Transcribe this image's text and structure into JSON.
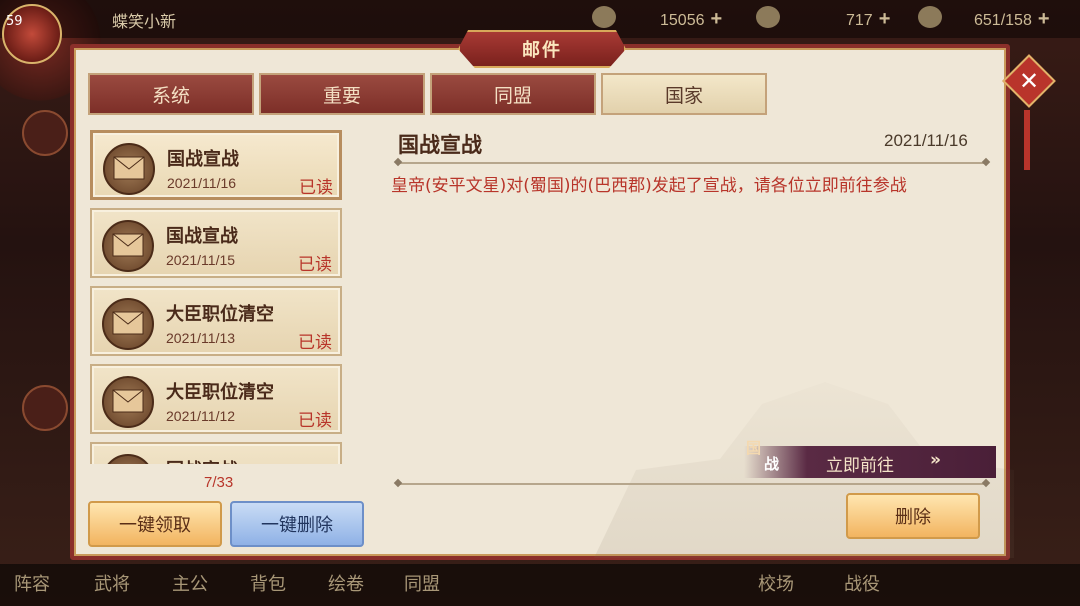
{
  "hud": {
    "level": "59",
    "player_name": "蝶笑小新",
    "resources": [
      {
        "icon": "silver-coin-icon",
        "value": "15056"
      },
      {
        "icon": "gold-ingot-icon",
        "value": "717"
      },
      {
        "icon": "grain-icon",
        "value": "651/158"
      }
    ],
    "bottom_nav": [
      "阵容",
      "武将",
      "主公",
      "背包",
      "绘卷",
      "同盟",
      "校场",
      "战役"
    ]
  },
  "dialog": {
    "title": "邮件",
    "close_icon": "close-icon",
    "tabs": [
      {
        "label": "系统",
        "active": false
      },
      {
        "label": "重要",
        "active": false
      },
      {
        "label": "同盟",
        "active": false
      },
      {
        "label": "国家",
        "active": true
      }
    ],
    "mails": [
      {
        "title": "国战宣战",
        "date": "2021/11/16",
        "status": "已读",
        "selected": true
      },
      {
        "title": "国战宣战",
        "date": "2021/11/15",
        "status": "已读",
        "selected": false
      },
      {
        "title": "大臣职位清空",
        "date": "2021/11/13",
        "status": "已读",
        "selected": false
      },
      {
        "title": "大臣职位清空",
        "date": "2021/11/12",
        "status": "已读",
        "selected": false
      },
      {
        "title": "国战宣战",
        "date": "",
        "status": "",
        "selected": false
      }
    ],
    "count": "7/33",
    "buttons": {
      "claim_all": "一键领取",
      "delete_all": "一键删除",
      "delete": "删除"
    },
    "detail": {
      "title": "国战宣战",
      "date": "2021/11/16",
      "body": "皇帝(安平文星)对(蜀国)的(巴西郡)发起了宣战，请各位立即前往参战"
    },
    "goto": {
      "badge_top": "国",
      "badge_bottom": "战",
      "label": "立即前往",
      "arrow": "»"
    }
  },
  "colors": {
    "frame": "#8b2f2a",
    "panel": "#efe7d7",
    "accent_red": "#b8352a",
    "gold_button": "#f2b460",
    "blue_button": "#8fb1e6"
  }
}
